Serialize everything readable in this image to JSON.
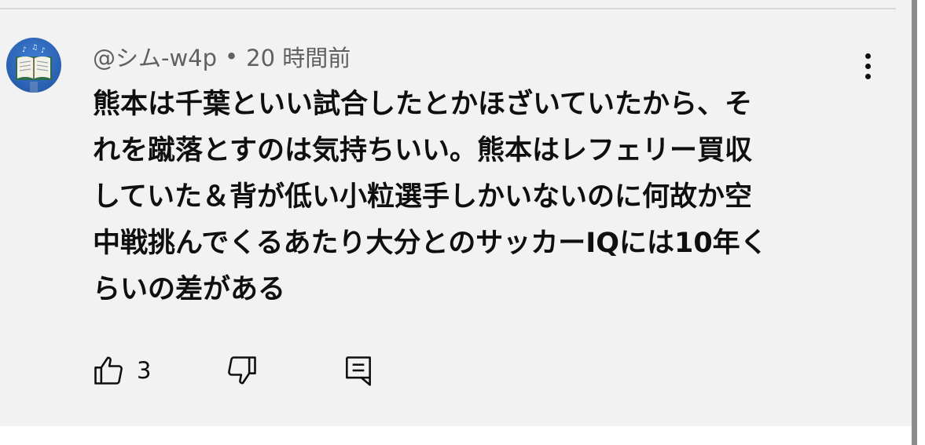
{
  "comment": {
    "author": "@シム-w4p",
    "separator": "•",
    "time": "20 時間前",
    "lines": [
      "熊本は千葉といい試合したとかほざいていたから、そ",
      "れを蹴落とすのは気持ちいい。熊本はレフェリー買収",
      "していた＆背が低い小粒選手しかいないのに何故か空",
      "中戦挑んでくるあたり大分とのサッカーIQには10年く",
      "らいの差がある"
    ],
    "likes": "3"
  },
  "icons": {
    "avatar": "book-music-avatar",
    "more": "more-vert-icon",
    "like": "thumbs-up-icon",
    "dislike": "thumbs-down-icon",
    "reply": "reply-comment-icon"
  },
  "colors": {
    "background": "#f2f2f2",
    "text": "#0f0f0f",
    "meta": "#606060",
    "avatar": "#2a5fb0"
  }
}
